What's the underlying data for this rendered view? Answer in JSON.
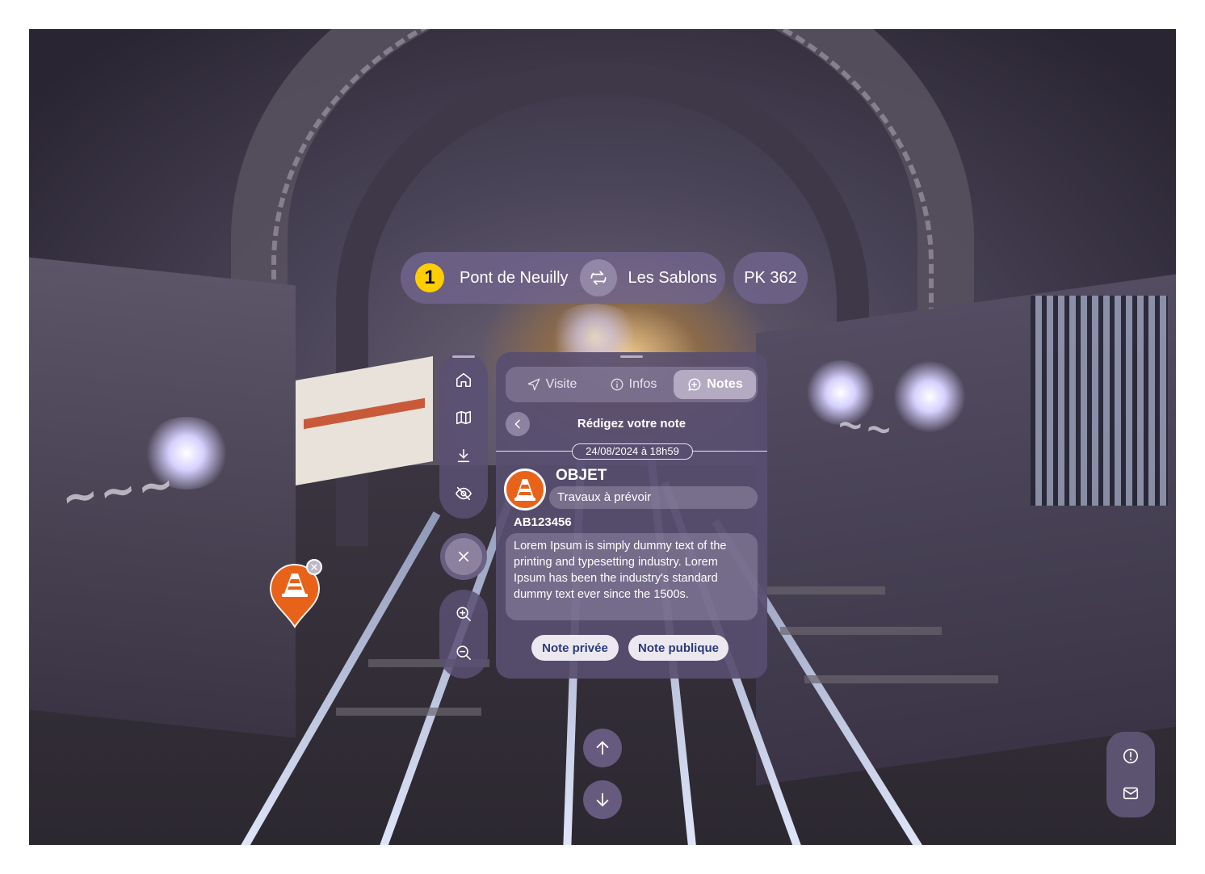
{
  "location": {
    "line_number": "1",
    "station_from": "Pont de Neuilly",
    "station_to": "Les Sablons",
    "pk": "PK 362"
  },
  "toolbar": {
    "items": [
      {
        "icon": "home-icon"
      },
      {
        "icon": "map-icon"
      },
      {
        "icon": "download-icon"
      },
      {
        "icon": "eye-off-icon"
      }
    ],
    "close_icon": "close-icon",
    "zoom_in_icon": "zoom-in-icon",
    "zoom_out_icon": "zoom-out-icon"
  },
  "panel": {
    "tabs": [
      {
        "label": "Visite",
        "icon": "navigation-icon",
        "active": false
      },
      {
        "label": "Infos",
        "icon": "info-icon",
        "active": false
      },
      {
        "label": "Notes",
        "icon": "note-plus-icon",
        "active": true
      }
    ],
    "title": "Rédigez votre note",
    "date": "24/08/2024 à 18h59",
    "object": {
      "title": "OBJET",
      "type": "Travaux à prévoir",
      "reference": "AB123456",
      "icon": "traffic-cone-icon"
    },
    "note_text": "Lorem Ipsum is simply dummy text of the printing and typesetting industry. Lorem Ipsum has been the industry's standard dummy text ever since the 1500s.",
    "buttons": {
      "private": "Note privée",
      "public": "Note publique"
    }
  },
  "colors": {
    "accent_orange": "#e8621a",
    "line_yellow": "#ffcd00",
    "button_text": "#2a3b7a",
    "panel_bg": "#584e70"
  },
  "nav": {
    "up_icon": "arrow-up-icon",
    "down_icon": "arrow-down-icon"
  },
  "dock": {
    "items": [
      {
        "icon": "alert-circle-icon"
      },
      {
        "icon": "mail-icon"
      }
    ]
  }
}
